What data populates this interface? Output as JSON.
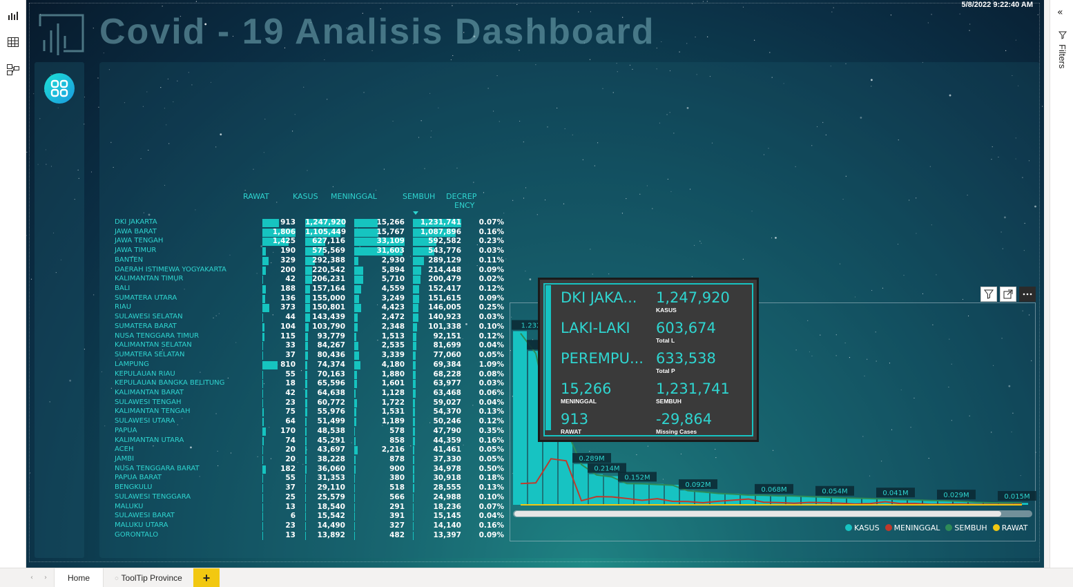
{
  "app": {
    "timestamp": "5/8/2022 9:22:40 AM",
    "title": "Covid - 19 Analisis Dashboard",
    "filters_label": "Filters",
    "colors": {
      "accent": "#17c3c2",
      "meninggal": "#c0392b",
      "sembuh": "#2e8b57",
      "rawat": "#f2c811"
    }
  },
  "left_rail": {
    "icons": [
      "report-view-icon",
      "data-view-icon",
      "model-view-icon"
    ]
  },
  "matrix": {
    "headers": {
      "rawat": "RAWAT",
      "kasus": "KASUS",
      "meninggal": "MENINGGAL",
      "sembuh": "SEMBUH",
      "decrepency_1": "DECREP",
      "decrepency_2": "ENCY"
    },
    "rows": [
      {
        "prov": "DKI JAKARTA",
        "rawat": "913",
        "kasus": "1,247,920",
        "meninggal": "15,266",
        "sembuh": "1,231,741",
        "dec": "0.07%"
      },
      {
        "prov": "JAWA BARAT",
        "rawat": "1,806",
        "kasus": "1,105,449",
        "meninggal": "15,767",
        "sembuh": "1,087,896",
        "dec": "0.16%"
      },
      {
        "prov": "JAWA TENGAH",
        "rawat": "1,425",
        "kasus": "627,116",
        "meninggal": "33,109",
        "sembuh": "592,582",
        "dec": "0.23%"
      },
      {
        "prov": "JAWA TIMUR",
        "rawat": "190",
        "kasus": "575,569",
        "meninggal": "31,603",
        "sembuh": "543,776",
        "dec": "0.03%"
      },
      {
        "prov": "BANTEN",
        "rawat": "329",
        "kasus": "292,388",
        "meninggal": "2,930",
        "sembuh": "289,129",
        "dec": "0.11%"
      },
      {
        "prov": "DAERAH ISTIMEWA YOGYAKARTA",
        "rawat": "200",
        "kasus": "220,542",
        "meninggal": "5,894",
        "sembuh": "214,448",
        "dec": "0.09%"
      },
      {
        "prov": "KALIMANTAN TIMUR",
        "rawat": "42",
        "kasus": "206,231",
        "meninggal": "5,710",
        "sembuh": "200,479",
        "dec": "0.02%"
      },
      {
        "prov": "BALI",
        "rawat": "188",
        "kasus": "157,164",
        "meninggal": "4,559",
        "sembuh": "152,417",
        "dec": "0.12%"
      },
      {
        "prov": "SUMATERA UTARA",
        "rawat": "136",
        "kasus": "155,000",
        "meninggal": "3,249",
        "sembuh": "151,615",
        "dec": "0.09%"
      },
      {
        "prov": "RIAU",
        "rawat": "373",
        "kasus": "150,801",
        "meninggal": "4,423",
        "sembuh": "146,005",
        "dec": "0.25%"
      },
      {
        "prov": "SULAWESI SELATAN",
        "rawat": "44",
        "kasus": "143,439",
        "meninggal": "2,472",
        "sembuh": "140,923",
        "dec": "0.03%"
      },
      {
        "prov": "SUMATERA BARAT",
        "rawat": "104",
        "kasus": "103,790",
        "meninggal": "2,348",
        "sembuh": "101,338",
        "dec": "0.10%"
      },
      {
        "prov": "NUSA TENGGARA TIMUR",
        "rawat": "115",
        "kasus": "93,779",
        "meninggal": "1,513",
        "sembuh": "92,151",
        "dec": "0.12%"
      },
      {
        "prov": "KALIMANTAN SELATAN",
        "rawat": "33",
        "kasus": "84,267",
        "meninggal": "2,535",
        "sembuh": "81,699",
        "dec": "0.04%"
      },
      {
        "prov": "SUMATERA SELATAN",
        "rawat": "37",
        "kasus": "80,436",
        "meninggal": "3,339",
        "sembuh": "77,060",
        "dec": "0.05%"
      },
      {
        "prov": "LAMPUNG",
        "rawat": "810",
        "kasus": "74,374",
        "meninggal": "4,180",
        "sembuh": "69,384",
        "dec": "1.09%"
      },
      {
        "prov": "KEPULAUAN RIAU",
        "rawat": "55",
        "kasus": "70,163",
        "meninggal": "1,880",
        "sembuh": "68,228",
        "dec": "0.08%"
      },
      {
        "prov": "KEPULAUAN BANGKA BELITUNG",
        "rawat": "18",
        "kasus": "65,596",
        "meninggal": "1,601",
        "sembuh": "63,977",
        "dec": "0.03%"
      },
      {
        "prov": "KALIMANTAN BARAT",
        "rawat": "42",
        "kasus": "64,638",
        "meninggal": "1,128",
        "sembuh": "63,468",
        "dec": "0.06%"
      },
      {
        "prov": "SULAWESI TENGAH",
        "rawat": "23",
        "kasus": "60,772",
        "meninggal": "1,722",
        "sembuh": "59,027",
        "dec": "0.04%"
      },
      {
        "prov": "KALIMANTAN TENGAH",
        "rawat": "75",
        "kasus": "55,976",
        "meninggal": "1,531",
        "sembuh": "54,370",
        "dec": "0.13%"
      },
      {
        "prov": "SULAWESI UTARA",
        "rawat": "64",
        "kasus": "51,499",
        "meninggal": "1,189",
        "sembuh": "50,246",
        "dec": "0.12%"
      },
      {
        "prov": "PAPUA",
        "rawat": "170",
        "kasus": "48,538",
        "meninggal": "578",
        "sembuh": "47,790",
        "dec": "0.35%"
      },
      {
        "prov": "KALIMANTAN UTARA",
        "rawat": "74",
        "kasus": "45,291",
        "meninggal": "858",
        "sembuh": "44,359",
        "dec": "0.16%"
      },
      {
        "prov": "ACEH",
        "rawat": "20",
        "kasus": "43,697",
        "meninggal": "2,216",
        "sembuh": "41,461",
        "dec": "0.05%"
      },
      {
        "prov": "JAMBI",
        "rawat": "20",
        "kasus": "38,228",
        "meninggal": "878",
        "sembuh": "37,330",
        "dec": "0.05%"
      },
      {
        "prov": "NUSA TENGGARA BARAT",
        "rawat": "182",
        "kasus": "36,060",
        "meninggal": "900",
        "sembuh": "34,978",
        "dec": "0.50%"
      },
      {
        "prov": "PAPUA BARAT",
        "rawat": "55",
        "kasus": "31,353",
        "meninggal": "380",
        "sembuh": "30,918",
        "dec": "0.18%"
      },
      {
        "prov": "BENGKULU",
        "rawat": "37",
        "kasus": "29,110",
        "meninggal": "518",
        "sembuh": "28,555",
        "dec": "0.13%"
      },
      {
        "prov": "SULAWESI TENGGARA",
        "rawat": "25",
        "kasus": "25,579",
        "meninggal": "566",
        "sembuh": "24,988",
        "dec": "0.10%"
      },
      {
        "prov": "MALUKU",
        "rawat": "13",
        "kasus": "18,540",
        "meninggal": "291",
        "sembuh": "18,236",
        "dec": "0.07%"
      },
      {
        "prov": "SULAWESI BARAT",
        "rawat": "6",
        "kasus": "15,542",
        "meninggal": "391",
        "sembuh": "15,145",
        "dec": "0.04%"
      },
      {
        "prov": "MALUKU UTARA",
        "rawat": "23",
        "kasus": "14,490",
        "meninggal": "327",
        "sembuh": "14,140",
        "dec": "0.16%"
      },
      {
        "prov": "GORONTALO",
        "rawat": "13",
        "kasus": "13,892",
        "meninggal": "482",
        "sembuh": "13,397",
        "dec": "0.09%"
      }
    ]
  },
  "chart_data": {
    "type": "bar",
    "visible_labels": [
      "1.232",
      "1.08",
      "0.289M",
      "0.214M",
      "0.152M",
      "0.092M",
      "0.068M",
      "0.054M",
      "0.041M",
      "0.029M",
      "0.015M"
    ],
    "categories_count": 34,
    "series": [
      {
        "name": "KASUS",
        "values": [
          1247920,
          1105449,
          627116,
          575569,
          292388,
          220542,
          206231,
          157164,
          155000,
          150801,
          143439,
          103790,
          93779,
          84267,
          80436,
          74374,
          70163,
          65596,
          64638,
          60772,
          55976,
          51499,
          48538,
          45291,
          43697,
          38228,
          36060,
          31353,
          29110,
          25579,
          18540,
          15542,
          14490,
          13892
        ]
      },
      {
        "name": "MENINGGAL",
        "values": [
          15266,
          15767,
          33109,
          31603,
          2930,
          5894,
          5710,
          4559,
          3249,
          4423,
          2472,
          2348,
          1513,
          2535,
          3339,
          4180,
          1880,
          1601,
          1128,
          1722,
          1531,
          1189,
          578,
          858,
          2216,
          878,
          900,
          380,
          518,
          566,
          291,
          391,
          327,
          482
        ]
      },
      {
        "name": "SEMBUH",
        "values": [
          1231741,
          1087896,
          592582,
          543776,
          289129,
          214448,
          200479,
          152417,
          151615,
          146005,
          140923,
          101338,
          92151,
          81699,
          77060,
          69384,
          68228,
          63977,
          63468,
          59027,
          54370,
          50246,
          47790,
          44359,
          41461,
          37330,
          34978,
          30918,
          28555,
          24988,
          18236,
          15145,
          14140,
          13397
        ]
      },
      {
        "name": "RAWAT",
        "values": [
          913,
          1806,
          1425,
          190,
          329,
          200,
          42,
          188,
          136,
          373,
          44,
          104,
          115,
          33,
          37,
          810,
          55,
          18,
          42,
          23,
          75,
          64,
          170,
          74,
          20,
          20,
          182,
          55,
          37,
          25,
          13,
          6,
          23,
          13
        ]
      }
    ],
    "legend": [
      "KASUS",
      "MENINGGAL",
      "SEMBUH",
      "RAWAT"
    ],
    "legend_position": "bottom-right",
    "sort": "descending by KASUS"
  },
  "tooltip": {
    "province": "DKI JAKA...",
    "kasus_value": "1,247,920",
    "kasus_label": "KASUS",
    "gender_l": "LAKI-LAKI",
    "total_l_value": "603,674",
    "total_l_label": "Total L",
    "gender_p": "PEREMPU...",
    "total_p_value": "633,538",
    "total_p_label": "Total P",
    "meninggal_value": "15,266",
    "meninggal_label": "MENINGGAL",
    "sembuh_value": "1,231,741",
    "sembuh_label": "SEMBUH",
    "rawat_value": "913",
    "rawat_label": "RAWAT",
    "missing_value": "-29,864",
    "missing_label": "Missing Cases"
  },
  "tabs": {
    "home": "Home",
    "tooltip_province": "ToolTip Province",
    "add": "+"
  }
}
